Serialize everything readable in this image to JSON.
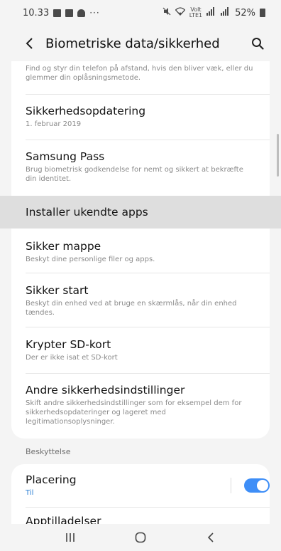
{
  "status_bar": {
    "time": "10.33",
    "network_label_top": "Volt",
    "network_label_bottom": "LTE1",
    "battery": "52%"
  },
  "header": {
    "title": "Biometriske data/sikkerhed"
  },
  "settings": {
    "top_partial_sub": "Find og styr din telefon på afstand, hvis den bliver væk, eller du glemmer din oplåsningsmetode.",
    "items": [
      {
        "title": "Sikkerhedsopdatering",
        "subtitle": "1. februar 2019"
      },
      {
        "title": "Samsung Pass",
        "subtitle": "Brug biometrisk godkendelse for nemt og sikkert at bekræfte din identitet."
      },
      {
        "title": "Installer ukendte apps",
        "subtitle": ""
      },
      {
        "title": "Sikker mappe",
        "subtitle": "Beskyt dine personlige filer og apps."
      },
      {
        "title": "Sikker start",
        "subtitle": "Beskyt din enhed ved at bruge en skærmlås, når din enhed tændes."
      },
      {
        "title": "Krypter SD-kort",
        "subtitle": "Der er ikke isat et SD-kort"
      },
      {
        "title": "Andre sikkerhedsindstillinger",
        "subtitle": "Skift andre sikkerhedsindstillinger som for eksempel dem for sikkerhedsopdateringer og lageret med legitimationsoplysninger."
      }
    ]
  },
  "protection": {
    "section_label": "Beskyttelse",
    "location": {
      "title": "Placering",
      "status": "Til",
      "toggle_on": true
    },
    "partial_next_title": "Apptilladelser"
  },
  "colors": {
    "accent": "#2a7fd4",
    "toggle_on": "#3e8ef7",
    "highlight": "#dedede",
    "background": "#f4f4f4",
    "card": "#ffffff"
  },
  "icons": {
    "back": "chevron-left-icon",
    "search": "search-icon",
    "nav_recents": "recents-icon",
    "nav_home": "home-icon",
    "nav_back": "back-icon"
  }
}
